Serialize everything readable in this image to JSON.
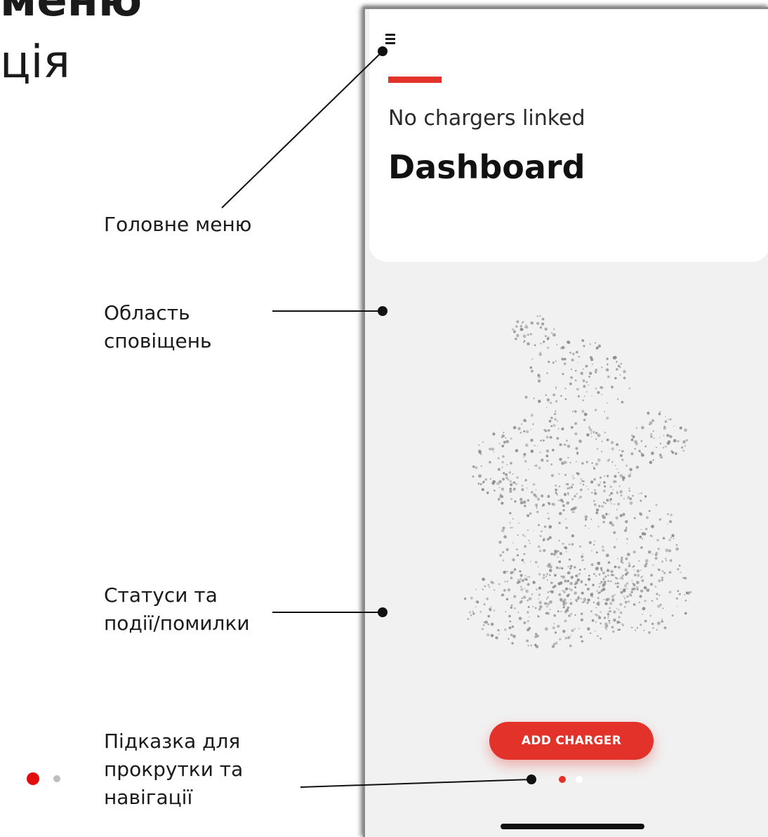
{
  "slide": {
    "title_line1": "меню",
    "title_line2": "ція"
  },
  "callouts": {
    "main_menu": "Головне меню",
    "notifications_line1": "Область",
    "notifications_line2": "сповіщень",
    "status_line1": "Статуси та",
    "status_line2": "події/помилки",
    "scroll_line1": "Підказка для",
    "scroll_line2": "прокрутки та",
    "scroll_line3": "навігації"
  },
  "app": {
    "menu_icon": "hamburger-menu-icon",
    "subtitle": "No chargers linked",
    "title": "Dashboard",
    "add_charger_label": "ADD CHARGER",
    "page_indicator": {
      "current": 1,
      "total": 2
    }
  },
  "colors": {
    "accent": "#e3322a",
    "background": "#f1f1f1",
    "card": "#ffffff"
  }
}
